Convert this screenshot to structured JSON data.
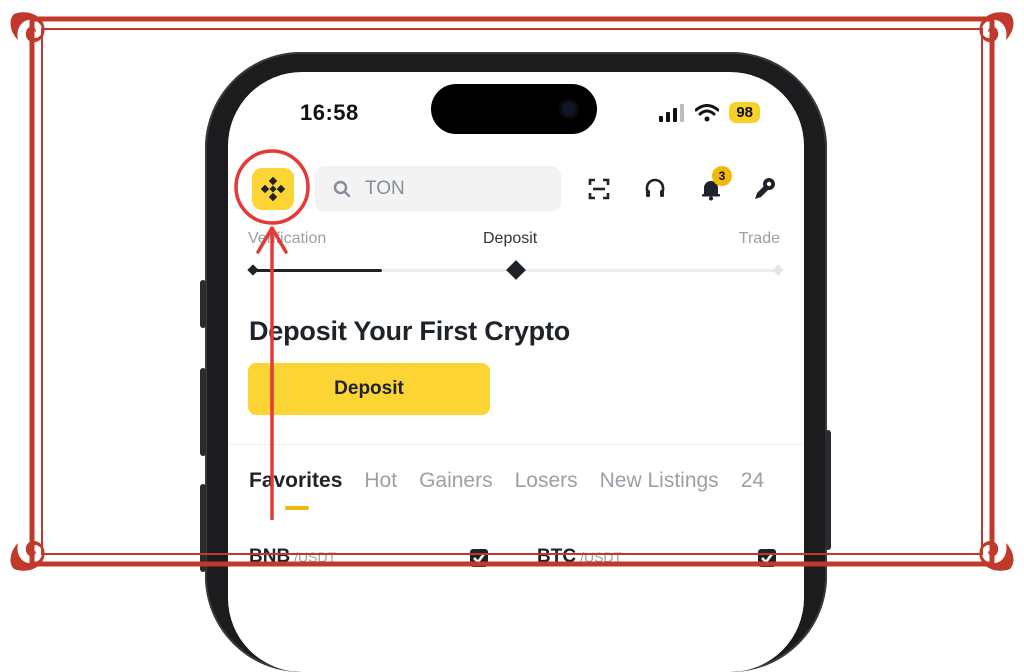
{
  "status_bar": {
    "time": "16:58",
    "battery": "98"
  },
  "header": {
    "search_placeholder": "TON",
    "notification_count": "3"
  },
  "progress": {
    "steps": [
      "Verification",
      "Deposit",
      "Trade"
    ],
    "current_step": "Deposit"
  },
  "promo": {
    "title": "Deposit Your First Crypto",
    "button_label": "Deposit"
  },
  "market_tabs": [
    "Favorites",
    "Hot",
    "Gainers",
    "Losers",
    "New Listings",
    "24"
  ],
  "active_tab": "Favorites",
  "pairs": [
    {
      "base": "BNB",
      "quote": "/USDT"
    },
    {
      "base": "BTC",
      "quote": "/USDT"
    }
  ],
  "colors": {
    "brand_yellow": "#fcd535",
    "annotation_red": "#e53935",
    "frame_red": "#c0392b"
  }
}
